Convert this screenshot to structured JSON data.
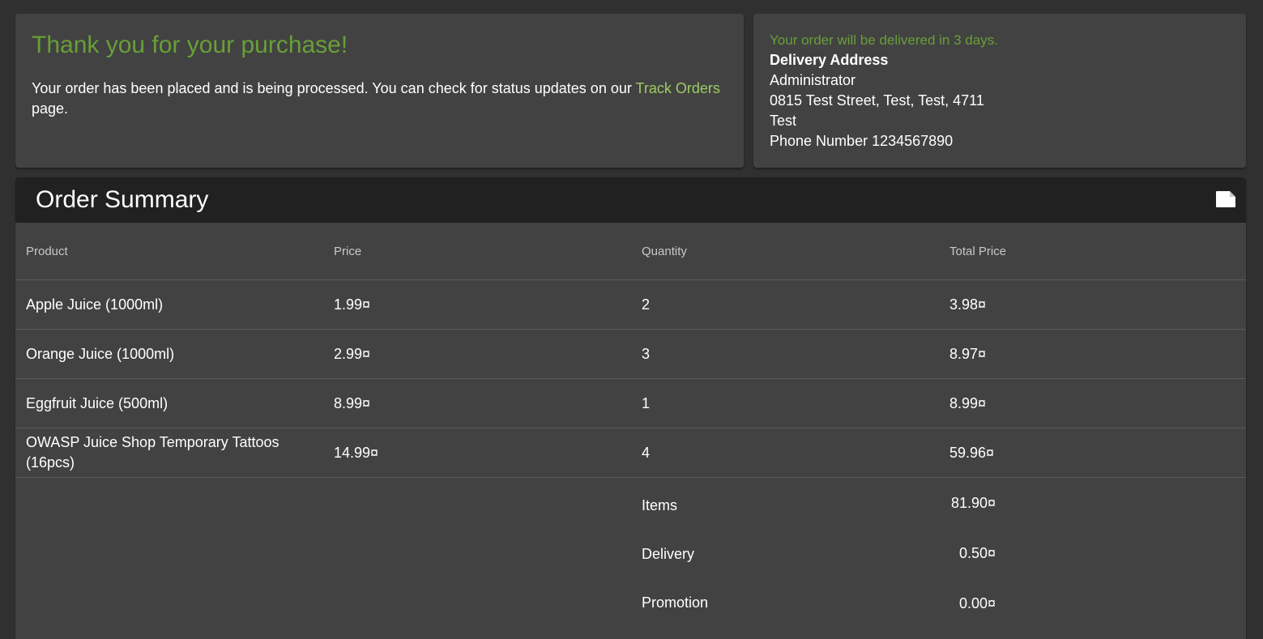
{
  "confirmation": {
    "title": "Thank you for your purchase!",
    "message_prefix": "Your order has been placed and is being processed. You can check for status updates on our ",
    "track_orders_link": "Track Orders",
    "message_suffix": " page."
  },
  "delivery": {
    "note": "Your order will be delivered in 3 days.",
    "heading": "Delivery Address",
    "name": "Administrator",
    "street": "0815 Test Street, Test, Test, 4711",
    "country": "Test",
    "phone": "Phone Number 1234567890"
  },
  "summary": {
    "title": "Order Summary",
    "export_icon": "pdf-file-icon",
    "columns": [
      "Product",
      "Price",
      "Quantity",
      "Total Price"
    ],
    "rows": [
      {
        "product": "Apple Juice (1000ml)",
        "price": "1.99¤",
        "quantity": "2",
        "total": "3.98¤"
      },
      {
        "product": "Orange Juice (1000ml)",
        "price": "2.99¤",
        "quantity": "3",
        "total": "8.97¤"
      },
      {
        "product": "Eggfruit Juice (500ml)",
        "price": "8.99¤",
        "quantity": "1",
        "total": "8.99¤"
      },
      {
        "product": "OWASP Juice Shop Temporary Tattoos (16pcs)",
        "price": "14.99¤",
        "quantity": "4",
        "total": "59.96¤"
      }
    ],
    "totals": {
      "items_label": "Items",
      "items_value": "81.90¤",
      "delivery_label": "Delivery",
      "delivery_value": "0.50¤",
      "promotion_label": "Promotion",
      "promotion_value": "0.00¤"
    }
  },
  "colors": {
    "background": "#303030",
    "card": "#424242",
    "header": "#212121",
    "accent_green": "#689f38",
    "link_green": "#9ccc65"
  }
}
